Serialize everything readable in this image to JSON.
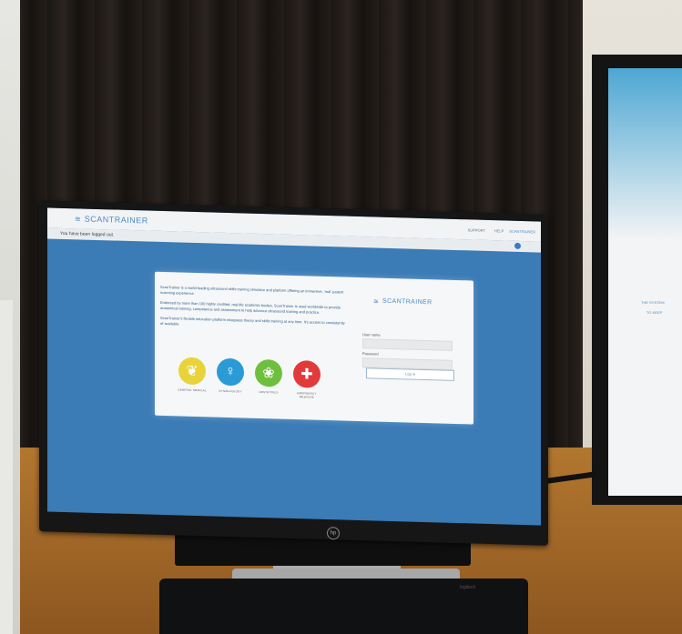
{
  "screen": {
    "brand": "SCANTRAINER",
    "nav": [
      "SUPPORT",
      "HELP"
    ],
    "corner_brand": "SCANTRAINER",
    "notice": "You have been logged out.",
    "intro": [
      "ScanTrainer is a world-leading ultrasound skills training simulator and platform offering an immersive, 'real' patient scanning experience.",
      "Endorsed by more than 100 highly credited, real-life academic bodies, ScanTrainer is used worldwide to provide anatomical training, competence and assessment to help advance ultrasound training and practice.",
      "ScanTrainer's flexible education platform integrates theory and skills training at any time. It's access to consistently of available."
    ],
    "categories": [
      {
        "label": "GENERAL MEDICAL",
        "color": "#e8d33a",
        "icon": "kidney-icon",
        "glyph": "❦"
      },
      {
        "label": "GYNAECOLOGY",
        "color": "#2b9bd6",
        "icon": "uterus-icon",
        "glyph": "♀"
      },
      {
        "label": "OBSTETRICS",
        "color": "#6fbf3f",
        "icon": "fetus-icon",
        "glyph": "❀"
      },
      {
        "label": "EMERGENCY MEDICINE",
        "color": "#e23a3a",
        "icon": "medical-cross-icon",
        "glyph": "✚"
      }
    ],
    "login": {
      "brand": "SCANTRAINER",
      "username_label": "User name",
      "password_label": "Password",
      "button": "Log in"
    },
    "monitor_logo": "hp"
  },
  "right_monitor": {
    "text": [
      "THE SYSTEM",
      "TO KEEP"
    ]
  },
  "keyboard_brand": "logitech"
}
